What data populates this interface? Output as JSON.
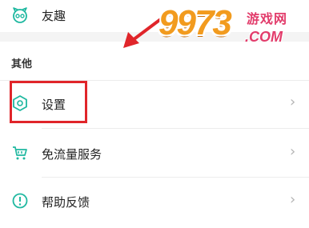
{
  "menu": {
    "top_item": {
      "label": "友趣",
      "icon": "friends-icon"
    },
    "section_title": "其他",
    "items": [
      {
        "label": "设置",
        "icon": "settings-hexagon-icon",
        "chevron": "›"
      },
      {
        "label": "免流量服务",
        "icon": "cart-icon",
        "chevron": "›"
      },
      {
        "label": "帮助反馈",
        "icon": "help-info-icon",
        "chevron": "›"
      }
    ]
  },
  "annotation": {
    "highlight_color": "#e0252a",
    "arrow_color": "#e0252a"
  },
  "watermark": {
    "number": "9973",
    "site_name": "游戏网",
    "domain": ".COM"
  },
  "colors": {
    "icon_accent": "#1fb8a0",
    "chevron": "#b5b5b5",
    "section_bg": "#f4f4f4"
  }
}
